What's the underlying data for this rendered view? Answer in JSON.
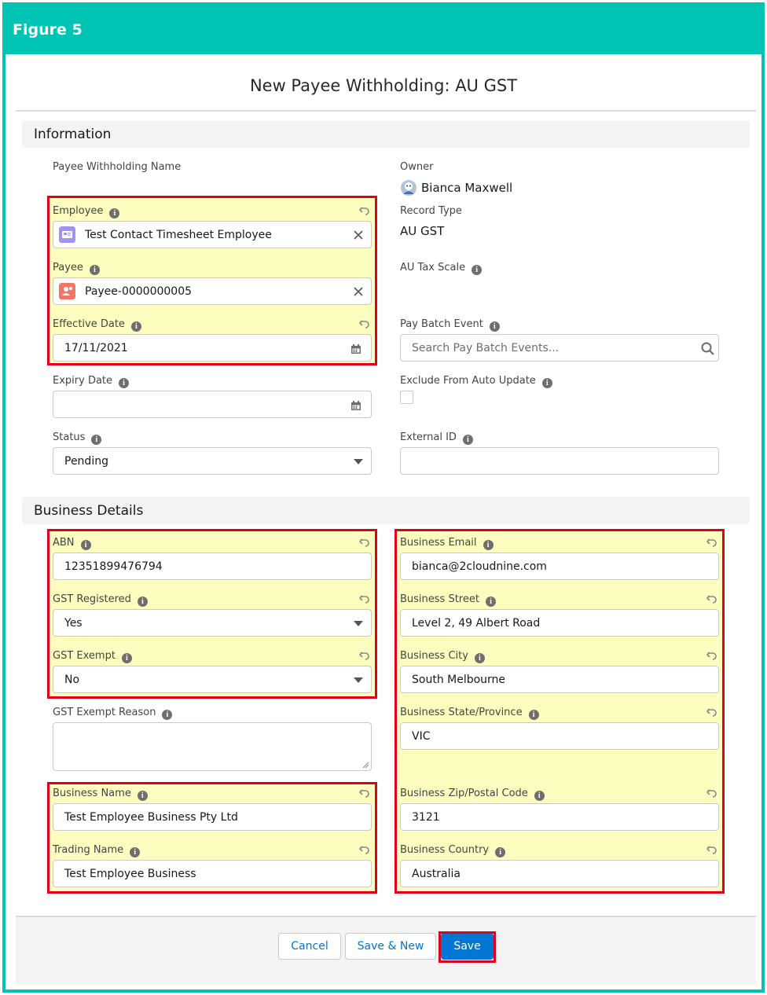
{
  "figure_label": "Figure 5",
  "modal_title": "New Payee Withholding: AU GST",
  "sections": {
    "information": "Information",
    "business_details": "Business Details"
  },
  "fields": {
    "payee_withholding_name": {
      "label": "Payee Withholding Name"
    },
    "owner": {
      "label": "Owner",
      "value": "Bianca Maxwell"
    },
    "employee": {
      "label": "Employee",
      "value": "Test Contact Timesheet Employee"
    },
    "record_type": {
      "label": "Record Type",
      "value": "AU GST"
    },
    "payee": {
      "label": "Payee",
      "value": "Payee-0000000005"
    },
    "au_tax_scale": {
      "label": "AU Tax Scale"
    },
    "effective_date": {
      "label": "Effective Date",
      "value": "17/11/2021"
    },
    "pay_batch_event": {
      "label": "Pay Batch Event",
      "placeholder": "Search Pay Batch Events..."
    },
    "expiry_date": {
      "label": "Expiry Date",
      "value": ""
    },
    "exclude_from_auto_update": {
      "label": "Exclude From Auto Update",
      "checked": false
    },
    "status": {
      "label": "Status",
      "value": "Pending"
    },
    "external_id": {
      "label": "External ID",
      "value": ""
    },
    "abn": {
      "label": "ABN",
      "value": "12351899476794"
    },
    "business_email": {
      "label": "Business Email",
      "value": "bianca@2cloudnine.com"
    },
    "gst_registered": {
      "label": "GST Registered",
      "value": "Yes"
    },
    "business_street": {
      "label": "Business Street",
      "value": "Level 2, 49 Albert Road"
    },
    "gst_exempt": {
      "label": "GST Exempt",
      "value": "No"
    },
    "business_city": {
      "label": "Business City",
      "value": "South Melbourne"
    },
    "gst_exempt_reason": {
      "label": "GST Exempt Reason",
      "value": ""
    },
    "business_state": {
      "label": "Business State/Province",
      "value": "VIC"
    },
    "business_name": {
      "label": "Business Name",
      "value": "Test Employee Business Pty Ltd"
    },
    "business_zip": {
      "label": "Business Zip/Postal Code",
      "value": "3121"
    },
    "trading_name": {
      "label": "Trading Name",
      "value": "Test Employee Business"
    },
    "business_country": {
      "label": "Business Country",
      "value": "Australia"
    }
  },
  "buttons": {
    "cancel": "Cancel",
    "save_new": "Save & New",
    "save": "Save"
  },
  "colors": {
    "frame": "#00c4b3",
    "highlight": "#fdfdc0",
    "annotation_box": "#e0001b",
    "brand": "#0176d3"
  },
  "icons": {
    "employee_chip": "contact-card-icon",
    "payee_chip": "payee-icon",
    "owner_avatar": "avatar",
    "clear": "close-icon",
    "date": "calendar-icon",
    "search": "search-icon",
    "dropdown": "caret-down-icon",
    "undo": "undo-icon",
    "help": "info-icon"
  }
}
